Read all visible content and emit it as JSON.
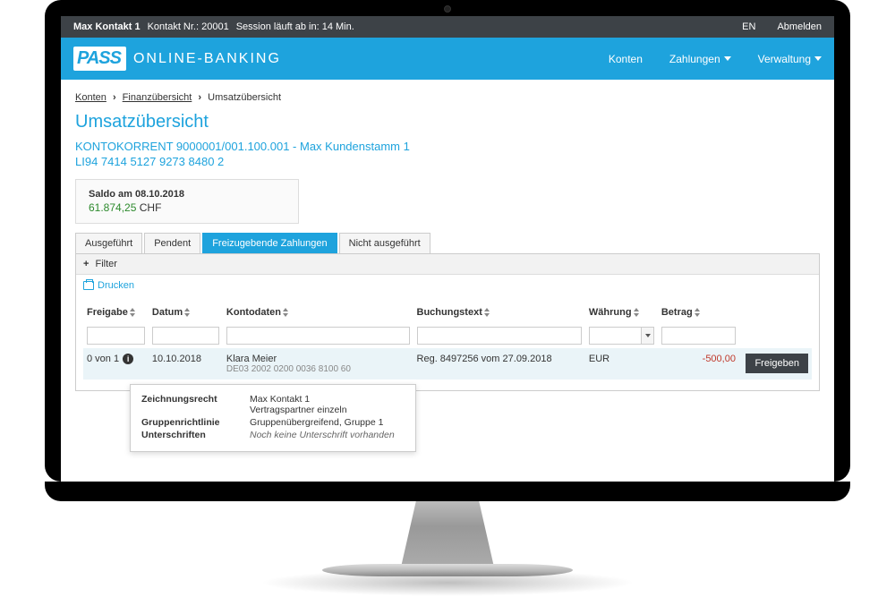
{
  "topbar": {
    "contact_label": "Max Kontakt 1",
    "contact_nr": "Kontakt Nr.: 20001",
    "session": "Session läuft ab in: 14 Min.",
    "lang": "EN",
    "logout": "Abmelden"
  },
  "header": {
    "logo_mark": "PASS",
    "logo_text": "ONLINE-BANKING",
    "nav": {
      "accounts": "Konten",
      "payments": "Zahlungen",
      "admin": "Verwaltung"
    }
  },
  "breadcrumb": {
    "a": "Konten",
    "b": "Finanzübersicht",
    "c": "Umsatzübersicht"
  },
  "page": {
    "title": "Umsatzübersicht",
    "account_line": "KONTOKORRENT 9000001/001.100.001 - Max Kundenstamm 1",
    "iban_line": "LI94 7414 5127 9273 8480 2"
  },
  "saldo": {
    "label": "Saldo am 08.10.2018",
    "amount": "61.874,25",
    "currency": "CHF"
  },
  "tabs": {
    "executed": "Ausgeführt",
    "pending": "Pendent",
    "approve": "Freizugebende Zahlungen",
    "notexec": "Nicht ausgeführt"
  },
  "filter": {
    "label": "Filter",
    "plus": "+"
  },
  "print": "Drucken",
  "columns": {
    "freigabe": "Freigabe",
    "datum": "Datum",
    "kontodaten": "Kontodaten",
    "buchungstext": "Buchungstext",
    "wahrung": "Währung",
    "betrag": "Betrag"
  },
  "row": {
    "freigabe_count": "0 von 1",
    "datum": "10.10.2018",
    "konto_name": "Klara Meier",
    "konto_iban": "DE03 2002 0200 0036 8100 60",
    "buchungstext": "Reg. 8497256 vom 27.09.2018",
    "wahrung": "EUR",
    "betrag": "-500,00",
    "action": "Freigeben"
  },
  "tooltip": {
    "r1_label": "Zeichnungsrecht",
    "r1_value": "Max Kontakt 1",
    "r1_value2": "Vertragspartner einzeln",
    "r2_label": "Gruppenrichtlinie",
    "r2_value": "Gruppenübergreifend, Gruppe 1",
    "r3_label": "Unterschriften",
    "r3_value": "Noch keine Unterschrift vorhanden"
  }
}
